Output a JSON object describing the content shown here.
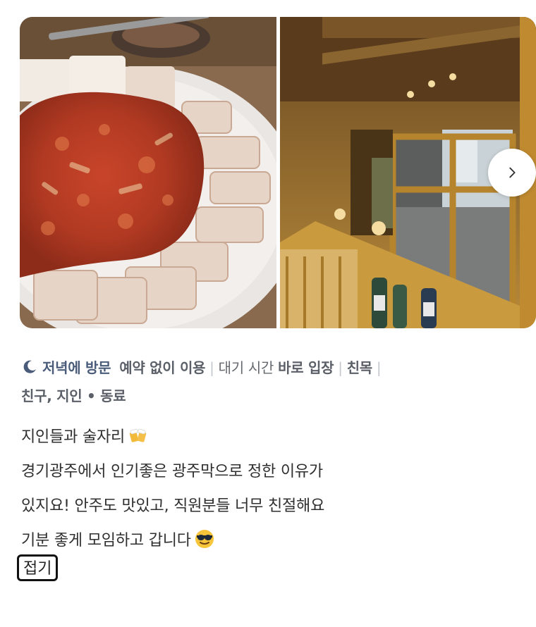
{
  "gallery": {
    "photos": [
      {
        "name": "bossam-kimchi-photo",
        "description_icon": "food-photo"
      },
      {
        "name": "restaurant-interior-photo",
        "description_icon": "interior-photo"
      }
    ],
    "next_icon": "chevron-right-icon"
  },
  "visit": {
    "icon": "moon-icon",
    "time": "저녁에 방문",
    "reservation": "예약 없이 이용",
    "wait_label": "대기 시간",
    "wait_value": "바로 입장",
    "purpose": "친목",
    "companions": "친구, 지인 • 동료"
  },
  "review": {
    "line1": "지인들과 술자리",
    "line1_emoji": "beer-mugs-emoji",
    "line2": "경기광주에서 인기좋은 광주막으로 정한 이유가",
    "line3": "있지요! 안주도 맛있고, 직원분들 너무 친절해요",
    "line4": "기분 좋게 모임하고 갑니다",
    "line4_emoji": "sunglasses-face-emoji"
  },
  "collapse_label": "접기",
  "colors": {
    "visit_accent": "#4a5c7a",
    "meta_text": "#666a70",
    "body_text": "#2f2f2f"
  }
}
